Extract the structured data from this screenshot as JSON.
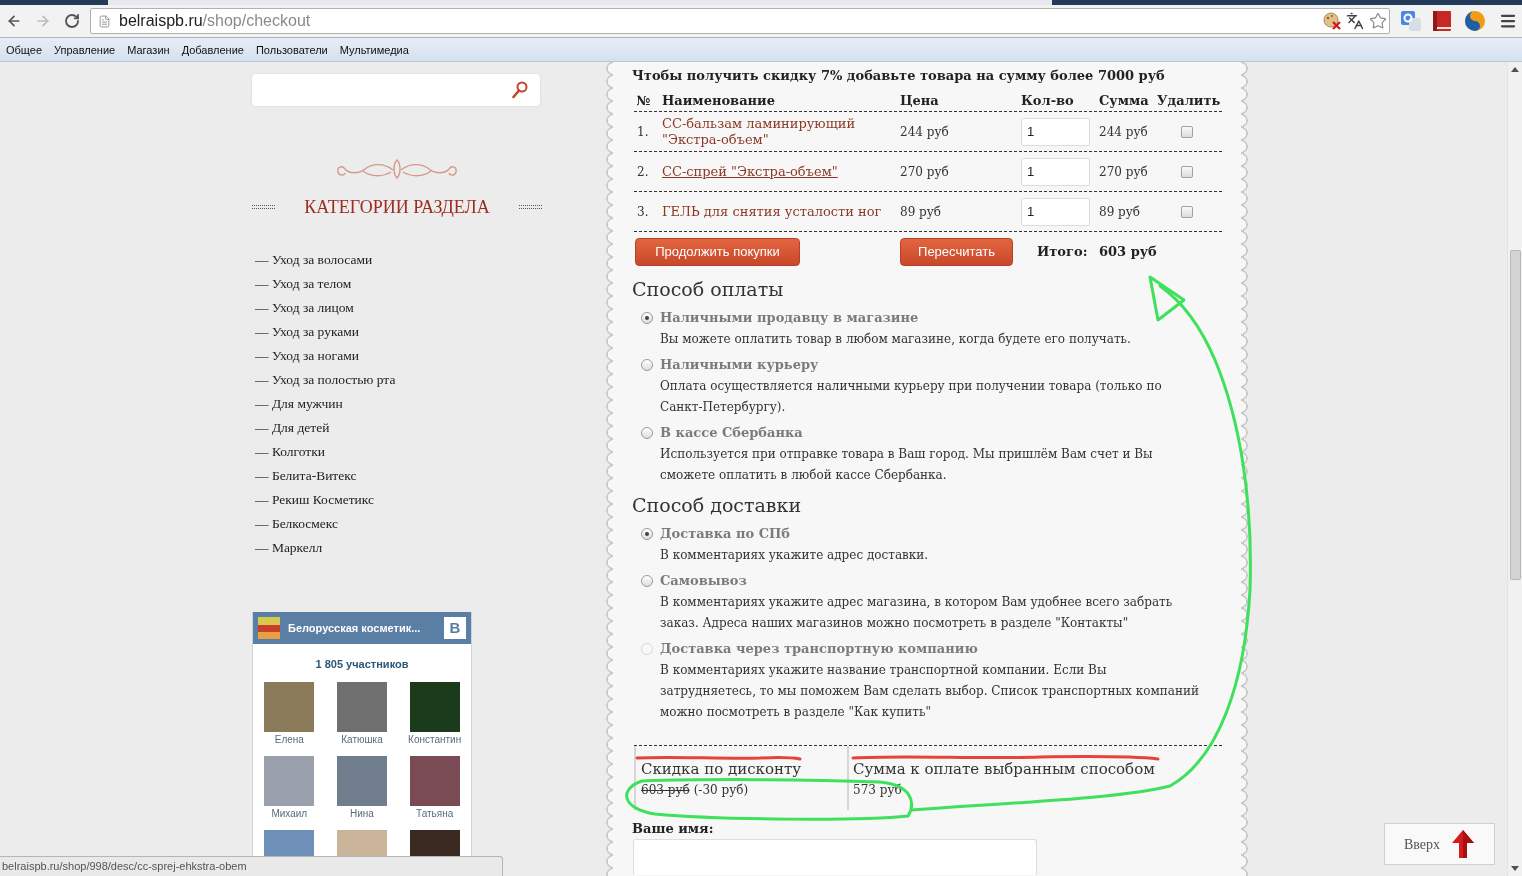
{
  "browser": {
    "address": {
      "host": "belraispb.ru",
      "path": "/shop/checkout"
    },
    "bookmarks": [
      "Общее",
      "Управление",
      "Магазин",
      "Добавление",
      "Пользователи",
      "Мультимедиа"
    ],
    "status_url": "belraispb.ru/shop/998/desc/cc-sprej-ehkstra-obem"
  },
  "sidebar": {
    "categories_title": "КАТЕГОРИИ РАЗДЕЛА",
    "categories": [
      "— Уход за волосами",
      "— Уход за телом",
      "— Уход за лицом",
      "— Уход за руками",
      "— Уход за ногами",
      "— Уход за полостью рта",
      "— Для мужчин",
      "— Для детей",
      "— Колготки",
      "— Белита-Витекс",
      "— Рекиш Косметикс",
      "— Белкосмекс",
      "— Маркелл"
    ]
  },
  "vk_widget": {
    "title": "Белорусская косметик...",
    "logo_letter": "В",
    "members_count": "1 805 участников",
    "members": [
      {
        "kind": "named",
        "name": "Елена"
      },
      {
        "kind": "named",
        "name": "Катюшка"
      },
      {
        "kind": "named",
        "name": "Константин"
      },
      {
        "kind": "named",
        "name": "Михаил"
      },
      {
        "kind": "named",
        "name": "Нина"
      },
      {
        "kind": "named",
        "name": "Татьяна"
      },
      {
        "kind": "cut"
      },
      {
        "kind": "cut"
      },
      {
        "kind": "cut"
      }
    ]
  },
  "cart": {
    "notice": "Чтобы получить скидку 7% добавьте товара на сумму более 7000 руб",
    "columns": [
      "№",
      "Наименование",
      "Цена",
      "Кол-во",
      "Сумма",
      "Удалить"
    ],
    "rows": [
      {
        "number": "1.",
        "name": "СС-бальзам ламинирующий \"Экстра-объем\"",
        "price": "244 руб",
        "quantity": "1",
        "sum": "244 руб",
        "delete_checked": false,
        "hovered": false
      },
      {
        "number": "2.",
        "name": "СС-спрей \"Экстра-объем\"",
        "price": "270 руб",
        "quantity": "1",
        "sum": "270 руб",
        "delete_checked": false,
        "hovered": true
      },
      {
        "number": "3.",
        "name": "ГЕЛЬ для снятия усталости ног",
        "price": "89 руб",
        "quantity": "1",
        "sum": "89 руб",
        "delete_checked": false,
        "hovered": false
      }
    ],
    "buttons": [
      "Продолжить покупки",
      "Пересчитать"
    ],
    "total_label": "Итого:",
    "total": "603 руб"
  },
  "payment": {
    "title": "Способ оплаты",
    "options": [
      {
        "label": "Наличными продавцу в магазине",
        "description": [
          "Вы можете оплатить товар в любом магазине, когда будете его получать."
        ],
        "selected": true
      },
      {
        "label": "Наличными курьеру",
        "description": [
          "Оплата осуществляется наличными курьеру при получении товара (только по",
          "Санкт-Петербургу)."
        ],
        "selected": false
      },
      {
        "label": "В кассе Сбербанка",
        "description": [
          "Используется при отправке товара в Ваш город. Мы пришлём Вам счет и Вы",
          "сможете оплатить в любой кассе Сбербанка."
        ],
        "selected": false
      }
    ]
  },
  "delivery": {
    "title": "Способ доставки",
    "options": [
      {
        "label": "Доставка по СПб",
        "description": [
          "В комментариях укажите адрес доставки."
        ],
        "selected": true,
        "disabled": false
      },
      {
        "label": "Самовывоз",
        "description": [
          "В комментариях укажите адрес магазина, в котором Вам удобнее всего забрать",
          "заказ. Адреса наших магазинов можно посмотреть в разделе \"Контакты\""
        ],
        "selected": false,
        "disabled": false
      },
      {
        "label": "Доставка через транспортную компанию",
        "description": [
          "В комментариях укажите название транспортной компании. Если Вы",
          "затрудняетесь, то мы поможем Вам сделать выбор. Список транспортных компаний",
          "можно посмотреть в разделе \"Как купить\""
        ],
        "selected": false,
        "disabled": true
      }
    ]
  },
  "summary": {
    "discount_label": "Скидка по дисконту",
    "old_price": "603 руб",
    "discount": "(-30 руб)",
    "pay_label": "Сумма к оплате выбранным способом",
    "pay_value": "573 руб"
  },
  "name_field": {
    "label": "Ваше имя:"
  },
  "back_to_top": "Вверх"
}
